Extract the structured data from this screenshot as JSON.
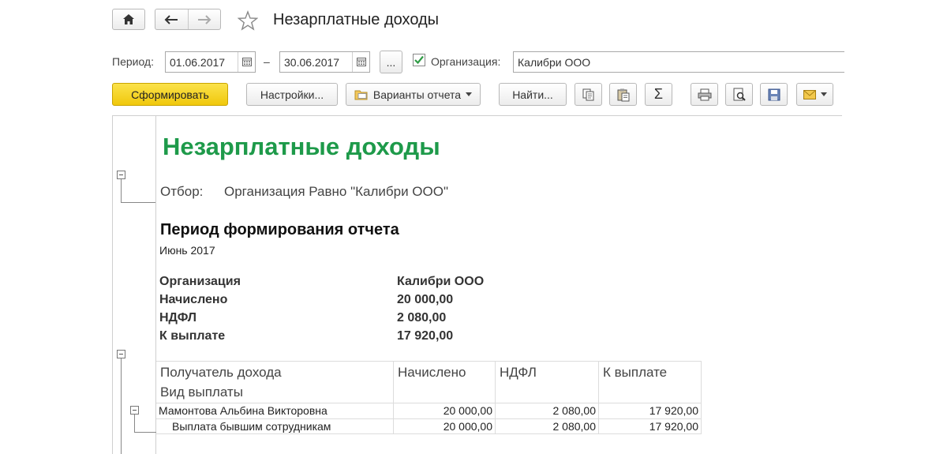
{
  "window": {
    "title": "Незарплатные доходы"
  },
  "params": {
    "period_label": "Период:",
    "date_from": "01.06.2017",
    "dash": "–",
    "date_to": "30.06.2017",
    "more_label": "...",
    "org_label": "Организация:",
    "org_checked": true,
    "org_value": "Калибри ООО"
  },
  "toolbar": {
    "generate": "Сформировать",
    "settings": "Настройки...",
    "variants": "Варианты отчета",
    "find": "Найти...",
    "sum_symbol": "Σ"
  },
  "report": {
    "title": "Незарплатные доходы",
    "filter_label": "Отбор:",
    "filter_value": "Организация Равно \"Калибри ООО\"",
    "period_heading": "Период формирования отчета",
    "period_value": "Июнь 2017",
    "summary": [
      {
        "label": "Организация",
        "value": "Калибри ООО"
      },
      {
        "label": "Начислено",
        "value": "20 000,00"
      },
      {
        "label": "НДФЛ",
        "value": "2 080,00"
      },
      {
        "label": "К выплате",
        "value": "17 920,00"
      }
    ],
    "table": {
      "headers": [
        "Получатель дохода",
        "Начислено",
        "НДФЛ",
        "К выплате"
      ],
      "subheader": "Вид выплаты",
      "rows": [
        {
          "name": "Мамонтова Альбина Викторовна",
          "accrued": "20 000,00",
          "ndfl": "2 080,00",
          "payout": "17 920,00"
        },
        {
          "name": "Выплата бывшим сотрудникам",
          "accrued": "20 000,00",
          "ndfl": "2 080,00",
          "payout": "17 920,00"
        }
      ]
    }
  },
  "colors": {
    "title_green": "#1e9a4a",
    "generate_yellow": "#f5d21c"
  }
}
